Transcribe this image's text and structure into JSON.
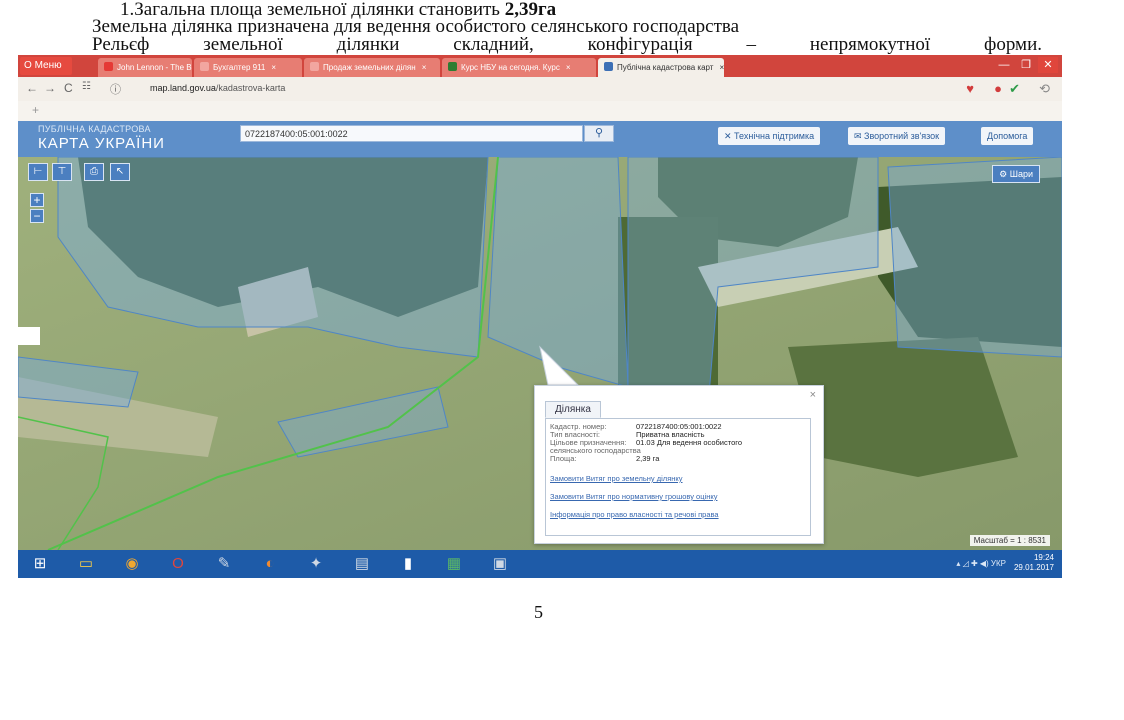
{
  "document": {
    "line1_prefix": "1.Загальна площа земельної ділянки становить ",
    "line1_area": "2,39га",
    "line2": "Земельна ділянка призначена для ведення особистого селянського господарства",
    "line3_words": [
      "Рельєф",
      "земельної",
      "ділянки",
      "складний,",
      "конфігурація",
      "–",
      "непрямокутної",
      "форми."
    ],
    "page_number": "5"
  },
  "browser": {
    "menu_label": "Меню",
    "tabs": [
      {
        "label": "John Lennon - The Best o",
        "icon_color": "#e53935"
      },
      {
        "label": "Бухгалтер 911",
        "icon_color": "#f2a6a0"
      },
      {
        "label": "Продаж земельних ділян",
        "icon_color": "#f2a6a0"
      },
      {
        "label": "Курс НБУ на сегодня. Курс",
        "icon_color": "#2e7d32"
      },
      {
        "label": "Публічна кадастрова карт",
        "icon_color": "#3c6fb5"
      }
    ],
    "url_host": "map.land.gov.ua",
    "url_path": "/kadastrova-karta"
  },
  "site": {
    "logo_line1": "ПУБЛІЧНА КАДАСТРОВА",
    "logo_line2": "КАРТА УКРАЇНИ",
    "search_value": "0722187400:05:001:0022",
    "support_label": "Технічна підтримка",
    "feedback_label": "Зворотний зв'язок",
    "help_label": "Допомога",
    "layers_label": "Шари"
  },
  "popup": {
    "tab_label": "Ділянка",
    "fields": [
      {
        "label": "Кадастр. номер:",
        "value": "0722187400:05:001:0022"
      },
      {
        "label": "Тип власності:",
        "value": "Приватна власність"
      },
      {
        "label": "Цільове призначення:",
        "value": "01.03 Для ведення особистого"
      },
      {
        "label": "селянського господарства",
        "value": ""
      },
      {
        "label": "Площа:",
        "value": "2,39 га"
      }
    ],
    "links": [
      "Замовити Витяг про земельну ділянку",
      "Замовити Витяг про нормативну грошову оцінку",
      "Інформація про право власності та речові права"
    ]
  },
  "map": {
    "scale_label": "Масштаб = 1 : 8531"
  },
  "taskbar": {
    "lang": "УКР",
    "time": "19:24",
    "date": "29.01.2017"
  }
}
